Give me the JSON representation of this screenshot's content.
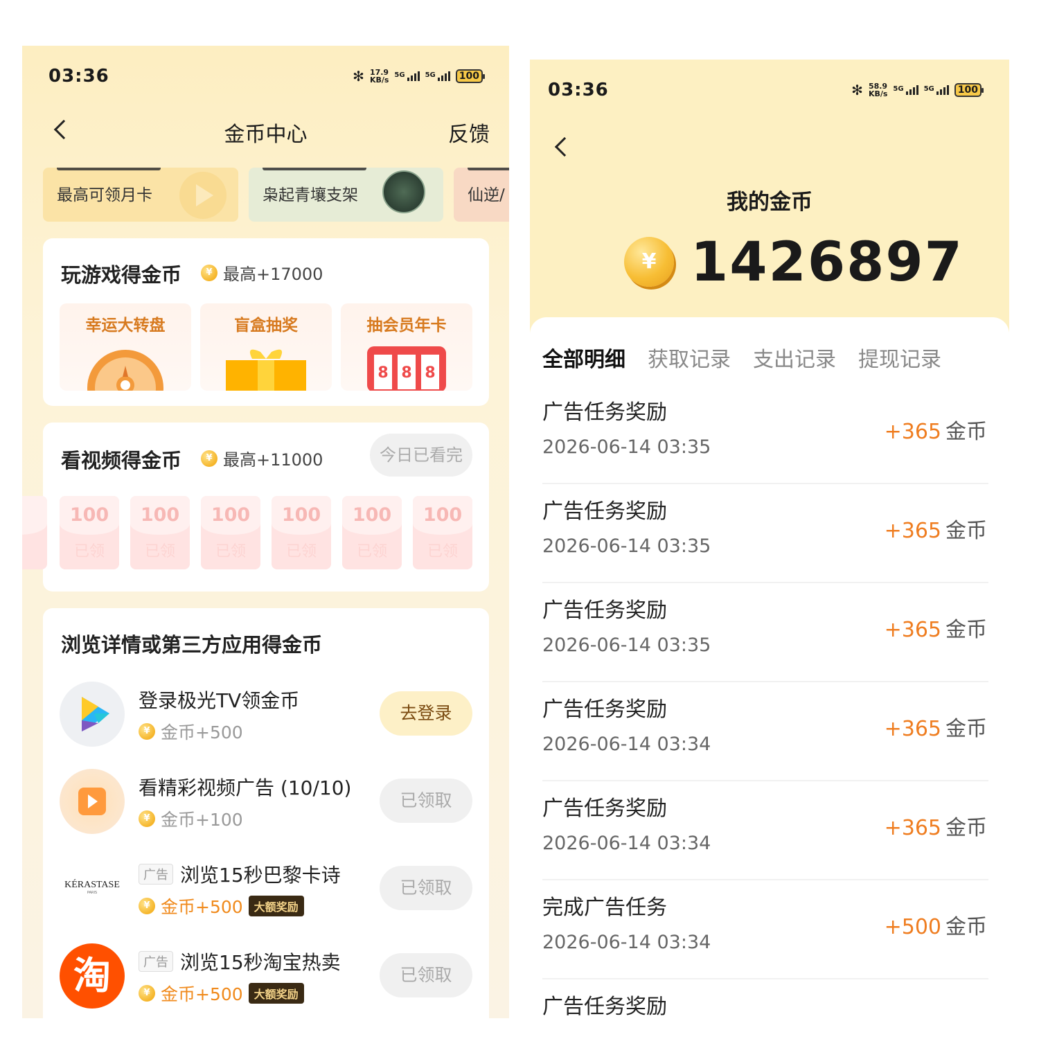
{
  "left": {
    "status": {
      "time": "03:36",
      "speed": [
        "17.9",
        "KB/s"
      ],
      "sig1": "5G",
      "sig2": "5G",
      "battery": "100"
    },
    "nav": {
      "title": "金币中心",
      "feedback": "反馈"
    },
    "promos": [
      {
        "text": "最高可领月卡"
      },
      {
        "text": "枭起青壤支架"
      },
      {
        "text": "仙逆/"
      }
    ],
    "games": {
      "title": "玩游戏得金币",
      "max": "最高+17000",
      "coin_glyph": "¥",
      "tiles": [
        {
          "label": "幸运大转盘"
        },
        {
          "label": "盲盒抽奖"
        },
        {
          "label": "抽会员年卡"
        }
      ],
      "slot_digits": [
        "8",
        "8",
        "8"
      ]
    },
    "video": {
      "title": "看视频得金币",
      "max": "最高+11000",
      "status": "今日已看完",
      "envelopes": [
        {
          "amount": "100",
          "state": "已领"
        },
        {
          "amount": "100",
          "state": "已领"
        },
        {
          "amount": "100",
          "state": "已领"
        },
        {
          "amount": "100",
          "state": "已领"
        },
        {
          "amount": "100",
          "state": "已领"
        },
        {
          "amount": "100",
          "state": "已领"
        }
      ]
    },
    "browse": {
      "title": "浏览详情或第三方应用得金币",
      "tasks": [
        {
          "name": "登录极光TV领金币",
          "reward": "金币+500",
          "button": "去登录"
        },
        {
          "name": "看精彩视频广告 (10/10)",
          "reward": "金币+100",
          "button": "已领取"
        },
        {
          "tag": "广告",
          "name": "浏览15秒巴黎卡诗",
          "reward": "金币+500",
          "badge": "大额奖励",
          "button": "已领取",
          "logo": "KÉRASTASE",
          "logo_sub": "PARIS"
        },
        {
          "tag": "广告",
          "name": "浏览15秒淘宝热卖",
          "reward": "金币+500",
          "badge": "大额奖励",
          "button": "已领取",
          "logo": "淘"
        }
      ]
    }
  },
  "right": {
    "status": {
      "time": "03:36",
      "speed": [
        "58.9",
        "KB/s"
      ],
      "sig1": "5G",
      "sig2": "5G",
      "battery": "100"
    },
    "balance_label": "我的金币",
    "coin_glyph": "¥",
    "balance": "1426897",
    "tabs": [
      "全部明细",
      "获取记录",
      "支出记录",
      "提现记录"
    ],
    "records": [
      {
        "title": "广告任务奖励",
        "time": "2026-06-14 03:35",
        "amount": "+365",
        "unit": "金币"
      },
      {
        "title": "广告任务奖励",
        "time": "2026-06-14 03:35",
        "amount": "+365",
        "unit": "金币"
      },
      {
        "title": "广告任务奖励",
        "time": "2026-06-14 03:35",
        "amount": "+365",
        "unit": "金币"
      },
      {
        "title": "广告任务奖励",
        "time": "2026-06-14 03:34",
        "amount": "+365",
        "unit": "金币"
      },
      {
        "title": "广告任务奖励",
        "time": "2026-06-14 03:34",
        "amount": "+365",
        "unit": "金币"
      },
      {
        "title": "完成广告任务",
        "time": "2026-06-14 03:34",
        "amount": "+500",
        "unit": "金币"
      },
      {
        "title": "广告任务奖励"
      }
    ]
  },
  "colors": {
    "header_bg": "#fdf0c2",
    "accent_orange": "#ef7d20",
    "game_text": "#d77a1f"
  }
}
